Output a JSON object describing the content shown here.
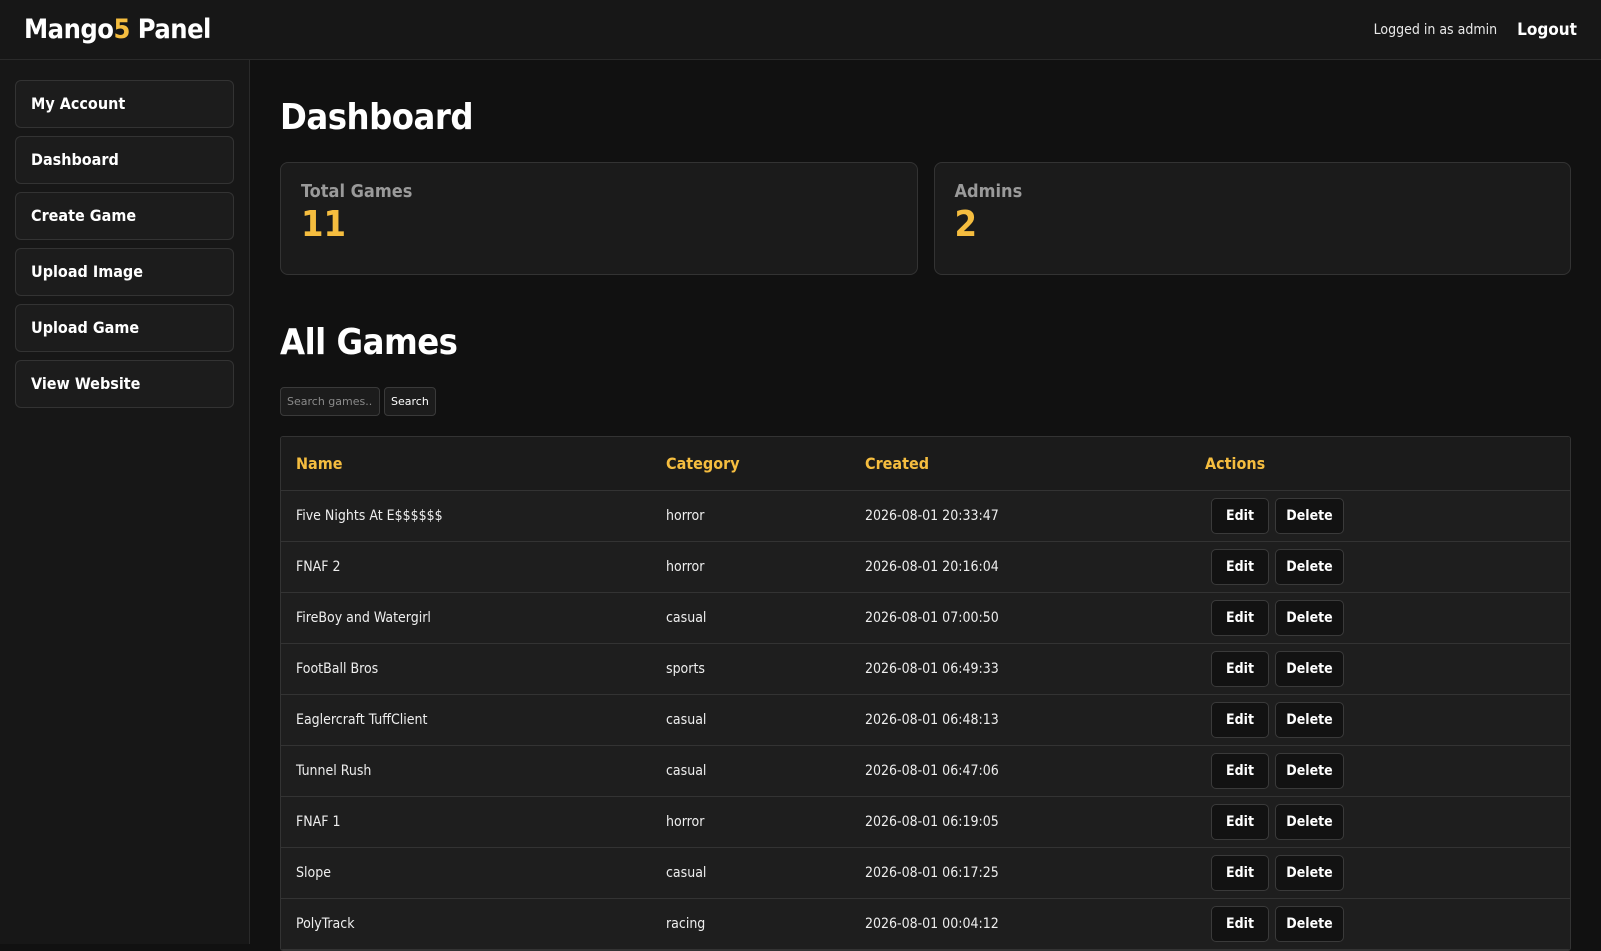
{
  "header": {
    "logo_prefix": "Mango",
    "logo_accent": "5",
    "logo_suffix": " Panel",
    "logged_in_text": "Logged in as admin",
    "logout_label": "Logout"
  },
  "sidebar": {
    "items": [
      {
        "label": "My Account"
      },
      {
        "label": "Dashboard"
      },
      {
        "label": "Create Game"
      },
      {
        "label": "Upload Image"
      },
      {
        "label": "Upload Game"
      },
      {
        "label": "View Website"
      }
    ]
  },
  "main": {
    "title": "Dashboard",
    "stats": [
      {
        "label": "Total Games",
        "value": "11"
      },
      {
        "label": "Admins",
        "value": "2"
      }
    ],
    "games_title": "All Games",
    "search": {
      "placeholder": "Search games...",
      "button_label": "Search"
    },
    "table": {
      "headers": [
        "Name",
        "Category",
        "Created",
        "Actions"
      ],
      "edit_label": "Edit",
      "delete_label": "Delete",
      "rows": [
        {
          "name": "Five Nights At E$$$$$$",
          "category": "horror",
          "created": "2026-08-01 20:33:47"
        },
        {
          "name": "FNAF 2",
          "category": "horror",
          "created": "2026-08-01 20:16:04"
        },
        {
          "name": "FireBoy and Watergirl",
          "category": "casual",
          "created": "2026-08-01 07:00:50"
        },
        {
          "name": "FootBall Bros",
          "category": "sports",
          "created": "2026-08-01 06:49:33"
        },
        {
          "name": "Eaglercraft TuffClient",
          "category": "casual",
          "created": "2026-08-01 06:48:13"
        },
        {
          "name": "Tunnel Rush",
          "category": "casual",
          "created": "2026-08-01 06:47:06"
        },
        {
          "name": "FNAF 1",
          "category": "horror",
          "created": "2026-08-01 06:19:05"
        },
        {
          "name": "Slope",
          "category": "casual",
          "created": "2026-08-01 06:17:25"
        },
        {
          "name": "PolyTrack",
          "category": "racing",
          "created": "2026-08-01 00:04:12"
        }
      ]
    }
  },
  "colors": {
    "accent": "#f5bd3f",
    "background": "#111111",
    "panel": "#1b1b1b"
  }
}
